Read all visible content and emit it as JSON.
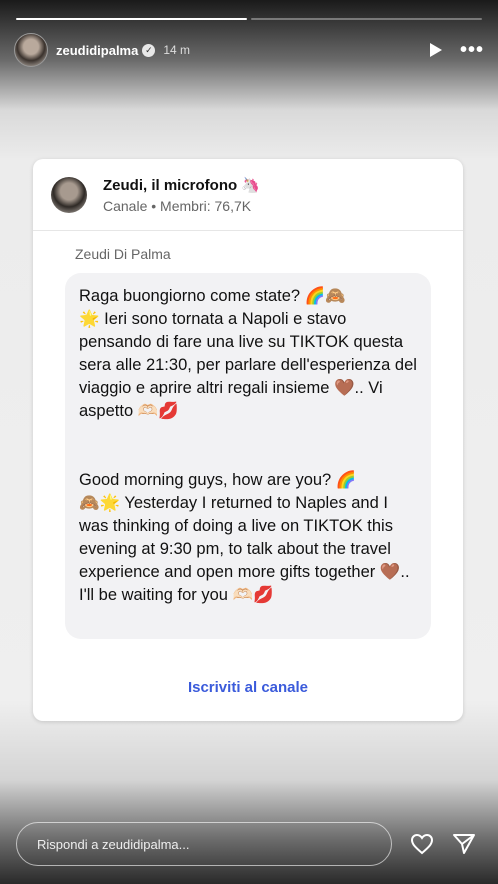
{
  "story": {
    "progress": [
      1.0,
      0.0
    ],
    "username": "zeudidipalma",
    "time": "14 m"
  },
  "channel": {
    "title": "Zeudi, il microfono 🦄",
    "subtitle": "Canale • Membri: 76,7K",
    "sender": "Zeudi Di Palma",
    "message_it": "Raga buongiorno come state? 🌈🙈\n🌟 Ieri sono tornata a Napoli e stavo pensando di fare una live su TIKTOK questa sera alle 21:30, per parlare dell'esperienza del viaggio e aprire altri regali insieme 🤎.. Vi aspetto 🫶🏻💋",
    "message_en": "Good morning guys, how are you? 🌈\n🙈🌟 Yesterday I returned to Naples and I was thinking of doing a live on TIKTOK this evening at 9:30 pm, to talk about the travel experience and open more gifts together 🤎.. I'll be waiting for you 🫶🏻💋",
    "subscribe_label": "Iscriviti al canale"
  },
  "footer": {
    "reply_placeholder": "Rispondi a zeudidipalma..."
  }
}
